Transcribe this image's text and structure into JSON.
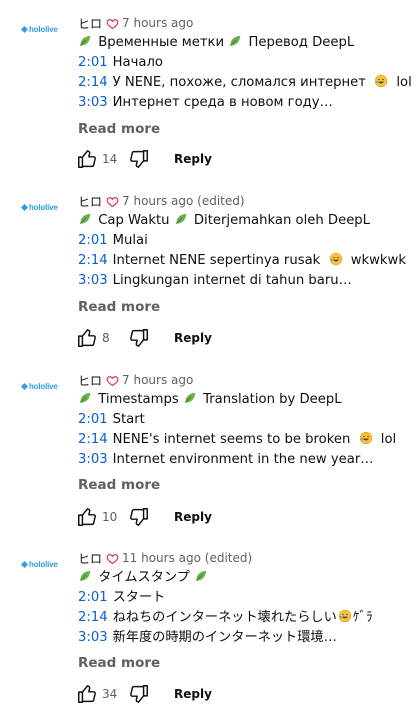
{
  "comments": [
    {
      "author": "ヒロ",
      "avatar_label": "hololive",
      "time": "7 hours ago",
      "lines": [
        {
          "title_left": "Временные метки",
          "title_right": "Перевод DeepL"
        },
        {
          "ts": "2:01",
          "text": "Начало"
        },
        {
          "ts": "2:14",
          "text": "У NENE, похоже, сломался интернет",
          "emoji_text": "lol"
        },
        {
          "ts": "3:03",
          "text": "Интернет среда в новом году…"
        }
      ],
      "read_more": "Read more",
      "likes": "14",
      "reply": "Reply"
    },
    {
      "author": "ヒロ",
      "avatar_label": "hololive",
      "time": "7 hours ago (edited)",
      "lines": [
        {
          "title_left": "Cap Waktu",
          "title_right": "Diterjemahkan oleh DeepL"
        },
        {
          "ts": "2:01",
          "text": "Mulai"
        },
        {
          "ts": "2:14",
          "text": "Internet NENE sepertinya rusak",
          "emoji_text": "wkwkwk"
        },
        {
          "ts": "3:03",
          "text": "Lingkungan internet di tahun baru…"
        }
      ],
      "read_more": "Read more",
      "likes": "8",
      "reply": "Reply"
    },
    {
      "author": "ヒロ",
      "avatar_label": "hololive",
      "time": "7 hours ago",
      "lines": [
        {
          "title_left": "Timestamps",
          "title_right": "Translation by DeepL"
        },
        {
          "ts": "2:01",
          "text": "Start"
        },
        {
          "ts": "2:14",
          "text": "NENE's internet seems to be broken",
          "emoji_text": "lol"
        },
        {
          "ts": "3:03",
          "text": "Internet environment in the new year…"
        }
      ],
      "read_more": "Read more",
      "likes": "10",
      "reply": "Reply"
    },
    {
      "author": "ヒロ",
      "avatar_label": "hololive",
      "time": "11 hours ago (edited)",
      "lines": [
        {
          "title_left": "タイムスタンプ",
          "title_right": ""
        },
        {
          "ts": "2:01",
          "text": "スタート"
        },
        {
          "ts": "2:14",
          "text": "ねねちのインターネット壊れたらしい",
          "emoji_text": "ｹﾞﾗ"
        },
        {
          "ts": "3:03",
          "text": "新年度の時期のインターネット環境…"
        }
      ],
      "read_more": "Read more",
      "likes": "34",
      "reply": "Reply"
    }
  ],
  "colors": {
    "timestamp": "#065fd4",
    "muted": "#606060",
    "leaf": "#6ab04c",
    "brand": "#2f9fe0"
  },
  "icons": [
    "leaf-icon",
    "rofl-emoji-icon",
    "heart-icon",
    "thumbs-up-icon",
    "thumbs-down-icon"
  ]
}
